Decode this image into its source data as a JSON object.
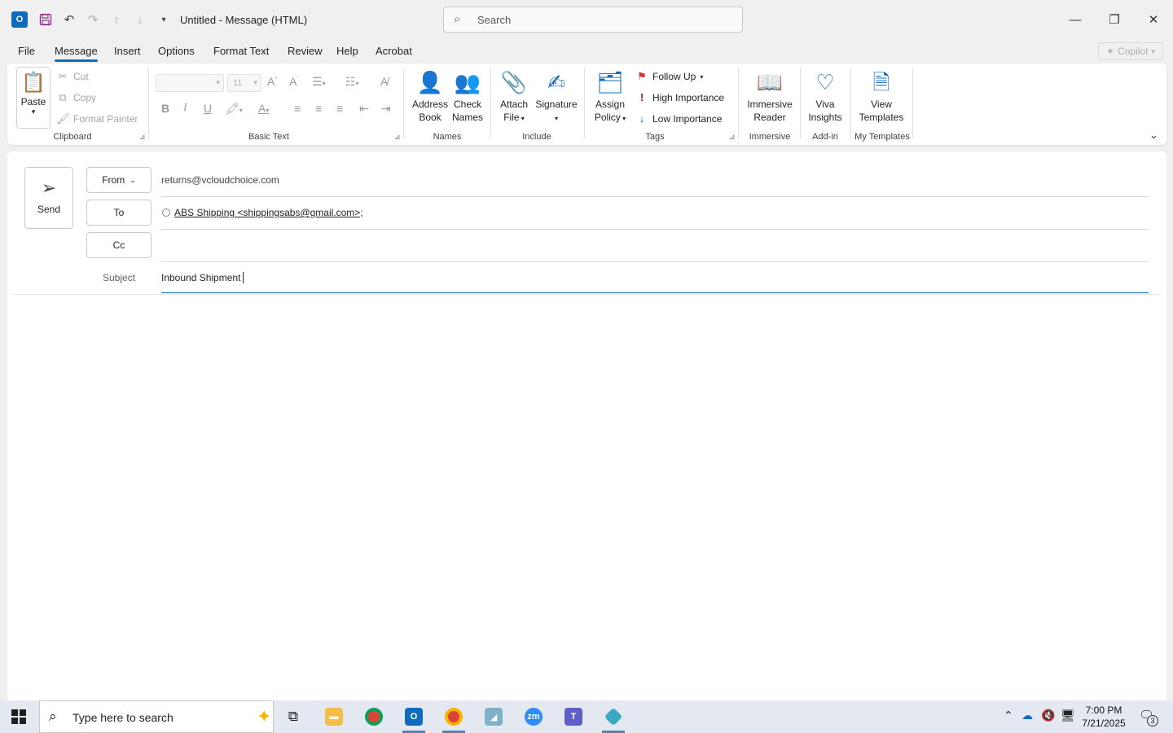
{
  "window": {
    "title": "Untitled  -  Message (HTML)",
    "search_placeholder": "Search"
  },
  "menu_tabs": [
    "File",
    "Message",
    "Insert",
    "Options",
    "Format Text",
    "Review",
    "Help",
    "Acrobat"
  ],
  "active_tab": "Message",
  "copilot_label": "Copilot",
  "ribbon": {
    "clipboard": {
      "paste": "Paste",
      "cut": "Cut",
      "copy": "Copy",
      "format_painter": "Format Painter",
      "label": "Clipboard"
    },
    "basic_text": {
      "font_size": "11",
      "label": "Basic Text"
    },
    "names": {
      "address_book_1": "Address",
      "address_book_2": "Book",
      "check_names_1": "Check",
      "check_names_2": "Names",
      "label": "Names"
    },
    "include": {
      "attach_1": "Attach",
      "attach_2": "File",
      "signature": "Signature",
      "label": "Include"
    },
    "tags": {
      "assign_1": "Assign",
      "assign_2": "Policy",
      "follow_up": "Follow Up",
      "high": "High Importance",
      "low": "Low Importance",
      "label": "Tags"
    },
    "immersive": {
      "btn_1": "Immersive",
      "btn_2": "Reader",
      "label": "Immersive"
    },
    "addin": {
      "btn_1": "Viva",
      "btn_2": "Insights",
      "label": "Add-in"
    },
    "templates": {
      "btn_1": "View",
      "btn_2": "Templates",
      "label": "My Templates"
    }
  },
  "compose": {
    "send": "Send",
    "from_label": "From",
    "from_value": "returns@vcloudchoice.com",
    "to_label": "To",
    "to_value": "ABS Shipping <shippingsabs@gmail.com>;",
    "cc_label": "Cc",
    "subject_label": "Subject",
    "subject_value": "Inbound Shipment"
  },
  "taskbar": {
    "search_placeholder": "Type here to search",
    "time": "7:00 PM",
    "date": "7/21/2025",
    "notifications": "3"
  },
  "colors": {
    "accent": "#0f6cbd",
    "flag": "#d13438",
    "high_importance": "#c50f1f",
    "low_importance": "#0f6cbd"
  }
}
